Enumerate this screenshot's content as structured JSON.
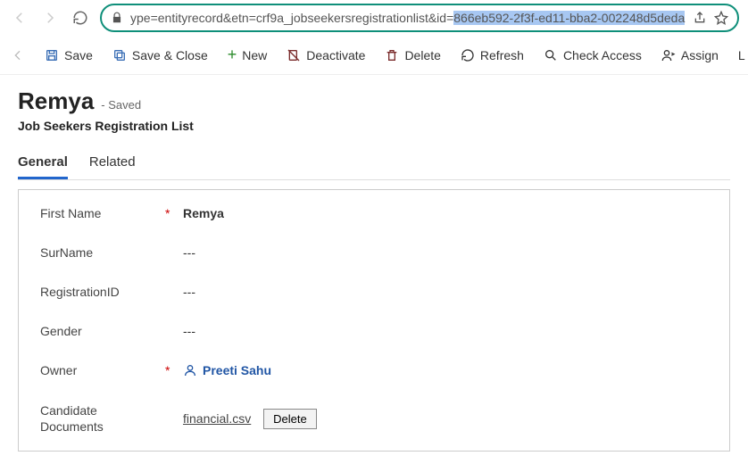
{
  "url": {
    "prefix": "ype=entityrecord&etn=crf9a_jobseekersregistrationlist&id=",
    "highlighted": "866eb592-2f3f-ed11-bba2-002248d5deda"
  },
  "cmd": {
    "save": "Save",
    "saveclose": "Save & Close",
    "new": "New",
    "deactivate": "Deactivate",
    "delete": "Delete",
    "refresh": "Refresh",
    "check": "Check Access",
    "assign": "Assign",
    "overflow": "L"
  },
  "header": {
    "title": "Remya",
    "status": "- Saved",
    "subtitle": "Job Seekers Registration List"
  },
  "tabs": {
    "general": "General",
    "related": "Related"
  },
  "fields": {
    "firstname": {
      "label": "First Name",
      "value": "Remya"
    },
    "surname": {
      "label": "SurName",
      "value": "---"
    },
    "regid": {
      "label": "RegistrationID",
      "value": "---"
    },
    "gender": {
      "label": "Gender",
      "value": "---"
    },
    "owner": {
      "label": "Owner",
      "value": "Preeti Sahu"
    },
    "docs": {
      "label1": "Candidate",
      "label2": "Documents",
      "file": "financial.csv",
      "delbtn": "Delete"
    }
  }
}
